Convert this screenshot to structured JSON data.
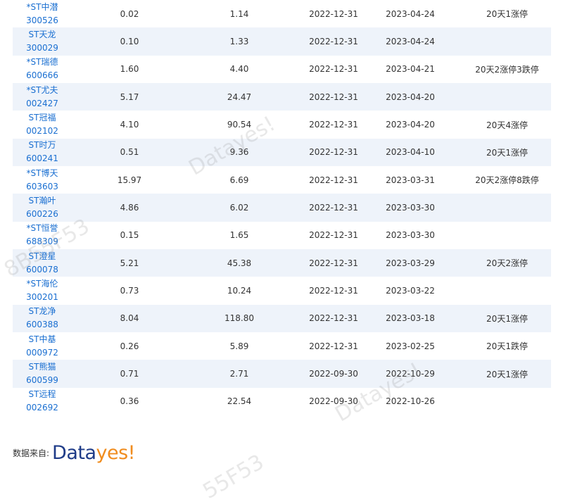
{
  "rows": [
    {
      "name": "*ST中潜",
      "code": "300526",
      "v1": "0.02",
      "v2": "1.14",
      "date1": "2022-12-31",
      "date2": "2023-04-24",
      "note": "20天1涨停"
    },
    {
      "name": "ST天龙",
      "code": "300029",
      "v1": "0.10",
      "v2": "1.33",
      "date1": "2022-12-31",
      "date2": "2023-04-24",
      "note": ""
    },
    {
      "name": "*ST瑞德",
      "code": "600666",
      "v1": "1.60",
      "v2": "4.40",
      "date1": "2022-12-31",
      "date2": "2023-04-21",
      "note": "20天2涨停3跌停"
    },
    {
      "name": "*ST尤夫",
      "code": "002427",
      "v1": "5.17",
      "v2": "24.47",
      "date1": "2022-12-31",
      "date2": "2023-04-20",
      "note": ""
    },
    {
      "name": "ST冠福",
      "code": "002102",
      "v1": "4.10",
      "v2": "90.54",
      "date1": "2022-12-31",
      "date2": "2023-04-20",
      "note": "20天4涨停"
    },
    {
      "name": "ST时万",
      "code": "600241",
      "v1": "0.51",
      "v2": "9.36",
      "date1": "2022-12-31",
      "date2": "2023-04-10",
      "note": "20天1涨停"
    },
    {
      "name": "*ST博天",
      "code": "603603",
      "v1": "15.97",
      "v2": "6.69",
      "date1": "2022-12-31",
      "date2": "2023-03-31",
      "note": "20天2涨停8跌停"
    },
    {
      "name": "ST瀚叶",
      "code": "600226",
      "v1": "4.86",
      "v2": "6.02",
      "date1": "2022-12-31",
      "date2": "2023-03-30",
      "note": ""
    },
    {
      "name": "*ST恒誉",
      "code": "688309",
      "v1": "0.15",
      "v2": "1.65",
      "date1": "2022-12-31",
      "date2": "2023-03-30",
      "note": ""
    },
    {
      "name": "ST澄星",
      "code": "600078",
      "v1": "5.21",
      "v2": "45.38",
      "date1": "2022-12-31",
      "date2": "2023-03-29",
      "note": "20天2涨停"
    },
    {
      "name": "*ST海伦",
      "code": "300201",
      "v1": "0.73",
      "v2": "10.24",
      "date1": "2022-12-31",
      "date2": "2023-03-22",
      "note": ""
    },
    {
      "name": "ST龙净",
      "code": "600388",
      "v1": "8.04",
      "v2": "118.80",
      "date1": "2022-12-31",
      "date2": "2023-03-18",
      "note": "20天1涨停"
    },
    {
      "name": "ST中基",
      "code": "000972",
      "v1": "0.26",
      "v2": "5.89",
      "date1": "2022-12-31",
      "date2": "2023-02-25",
      "note": "20天1跌停"
    },
    {
      "name": "ST熊猫",
      "code": "600599",
      "v1": "0.71",
      "v2": "2.71",
      "date1": "2022-09-30",
      "date2": "2022-10-29",
      "note": "20天1涨停"
    },
    {
      "name": "ST远程",
      "code": "002692",
      "v1": "0.36",
      "v2": "22.54",
      "date1": "2022-09-30",
      "date2": "2022-10-26",
      "note": ""
    }
  ],
  "footer": {
    "label": "数据来自:",
    "logo_part1": "Data",
    "logo_part2": "yes!"
  },
  "watermarks": [
    "Datayes!",
    "8B55F53",
    "Datayes!",
    "55F53"
  ],
  "colors": {
    "link": "#1a6fd1",
    "alt_row": "#eef3fa",
    "logo_blue": "#1f3c88",
    "logo_orange": "#f08c1e"
  }
}
